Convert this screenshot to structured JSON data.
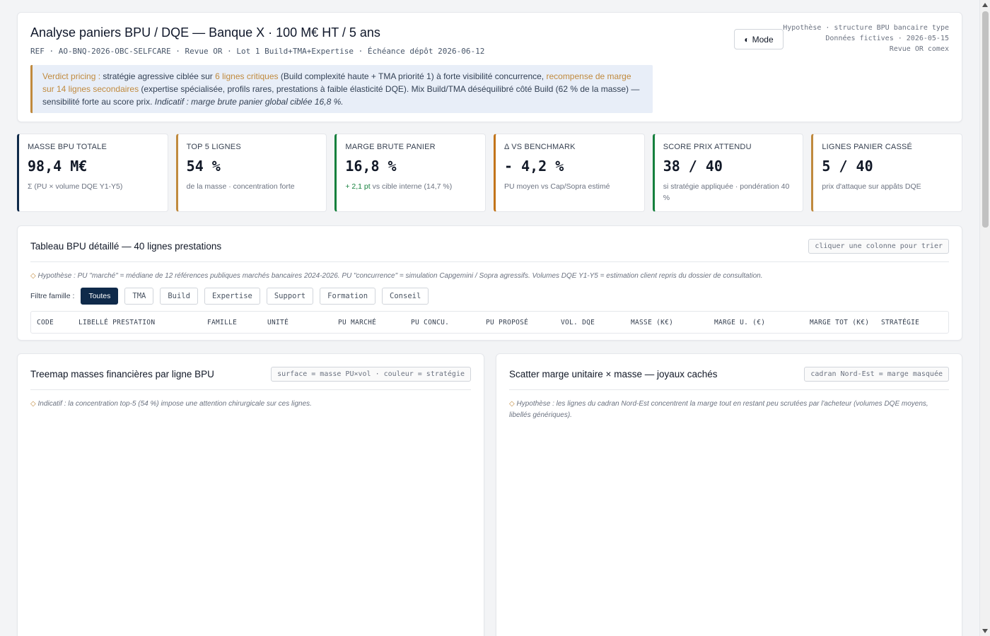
{
  "header": {
    "title": "Analyse paniers BPU / DQE — Banque X · 100 M€ HT / 5 ans",
    "subline": "REF · AO-BNQ-2026-OBC-SELFCARE · Revue OR · Lot 1 Build+TMA+Expertise · Échéance dépôt 2026-06-12",
    "mode_label": "Mode",
    "hyp_lines": [
      "Hypothèse · structure BPU bancaire type",
      "Données fictives · 2026-05-15",
      "Revue OR comex"
    ],
    "verdict": {
      "t1": "Verdict pricing :",
      "t2": " stratégie agressive ciblée sur ",
      "t3": "6 lignes critiques",
      "t4": " (Build complexité haute + TMA priorité 1) à forte visibilité concurrence, ",
      "t5": "recompense de marge sur 14 lignes secondaires",
      "t6": " (expertise spécialisée, profils rares, prestations à faible élasticité DQE). Mix Build/TMA déséquilibré côté Build (62 % de la masse) — sensibilité forte au score prix. ",
      "t7": "Indicatif : marge brute panier global ciblée 16,8 %."
    }
  },
  "kpis": [
    {
      "label": "MASSE BPU TOTALE",
      "value": "98,4 M€",
      "sub": "Σ (PU × volume DQE Y1-Y5)",
      "color": "#0f2a4a"
    },
    {
      "label": "TOP 5 LIGNES",
      "value": "54 %",
      "sub": "de la masse · concentration forte",
      "color": "#c08a3e"
    },
    {
      "label": "MARGE BRUTE PANIER",
      "value": "16,8 %",
      "sub_up": "+ 2,1 pt",
      "sub": " vs cible interne (14,7 %)",
      "color": "#15803d"
    },
    {
      "label": "Δ VS BENCHMARK",
      "value": "- 4,2 %",
      "sub": "PU moyen vs Cap/Sopra estimé",
      "color": "#c2741a"
    },
    {
      "label": "SCORE PRIX ATTENDU",
      "value": "38 / 40",
      "sub": "si stratégie appliquée · pondération 40 %",
      "color": "#15803d"
    },
    {
      "label": "LIGNES PANIER CASSÉ",
      "value": "5 / 40",
      "sub": "prix d'attaque sur appâts DQE",
      "color": "#c08a3e"
    }
  ],
  "table": {
    "title": "Tableau BPU détaillé — 40 lignes prestations",
    "sort_hint": "cliquer une colonne pour trier",
    "note": "Hypothèse : PU \"marché\" = médiane de 12 références publiques marchés bancaires 2024-2026. PU \"concurrence\" = simulation Capgemini / Sopra agressifs. Volumes DQE Y1-Y5 = estimation client repris du dossier de consultation.",
    "filter_label": "Filtre famille :",
    "filters": [
      "Toutes",
      "TMA",
      "Build",
      "Expertise",
      "Support",
      "Formation",
      "Conseil"
    ],
    "columns": [
      "CODE",
      "LIBELLÉ PRESTATION",
      "FAMILLE",
      "UNITÉ",
      "PU MARCHÉ",
      "PU CONCU.",
      "PU PROPOSÉ",
      "VOL. DQE",
      "MASSE (K€)",
      "MARGE U. (€)",
      "MARGE TOT (K€)",
      "STRATÉGIE"
    ]
  },
  "treemap": {
    "title": "Treemap masses financières par ligne BPU",
    "legend": "surface = masse PU×vol · couleur = stratégie",
    "note": "Indicatif : la concentration top-5 (54 %) impose une attention chirurgicale sur ces lignes."
  },
  "scatter": {
    "title": "Scatter marge unitaire × masse — joyaux cachés",
    "legend": "cadran Nord-Est = marge masquée",
    "note": "Hypothèse : les lignes du cadran Nord-Est concentrent la marge tout en restant peu scrutées par l'acheteur (volumes DQE moyens, libellés génériques)."
  }
}
